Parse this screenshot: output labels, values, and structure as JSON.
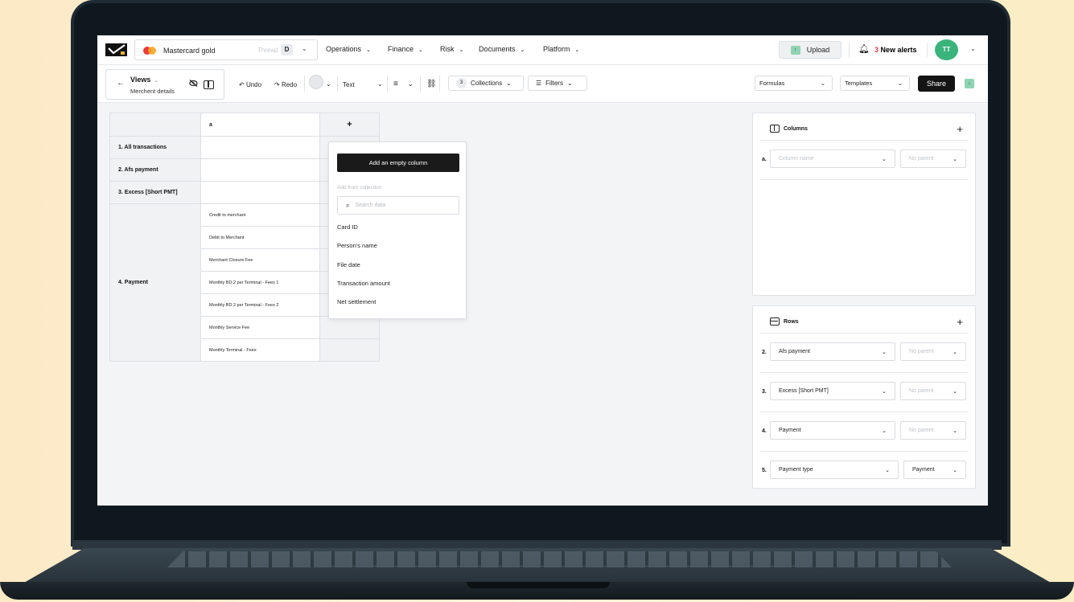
{
  "header": {
    "account_name": "Mastercard gold",
    "thread_label": "Thread",
    "thread_badge": "D",
    "nav": [
      "Operations",
      "Finance",
      "Risk",
      "Documents",
      "Platform"
    ],
    "upload_label": "Upload",
    "alerts_count": "3",
    "alerts_label": "New alerts",
    "avatar_initials": "TT"
  },
  "toolbar": {
    "views_title": "Views",
    "views_subtitle": "Merchent details",
    "undo": "Undo",
    "redo": "Redo",
    "text_style": "Text",
    "collections_count": "3",
    "collections_label": "Collections",
    "filters_label": "Filters",
    "formulas": "Formulas",
    "templates": "Templates",
    "share": "Share"
  },
  "grid": {
    "column_header": "a",
    "add_column_symbol": "+",
    "rows": [
      {
        "label": "1. All transactions"
      },
      {
        "label": "2. Afs payment"
      },
      {
        "label": "3. Excess [Short PMT]"
      }
    ],
    "payment_label": "4. Payment",
    "payment_items": [
      "Credit to merchant",
      "Debit to Merchant",
      "Merchant Closure Fee",
      "Monthly BD 2 per Terminal - Fees 1",
      "Monthly BD 2 per Terminal - Fees 2",
      "Monthly Service Fee",
      "Monthly Terminal - Fees"
    ]
  },
  "dropdown": {
    "add_empty": "Add an empty column",
    "from_collection": "Add from collection",
    "search_placeholder": "Search data",
    "items": [
      "Card ID",
      "Person's name",
      "File date",
      "Transaction amount",
      "Net settlement"
    ]
  },
  "columns_panel": {
    "title": "Columns",
    "rows": [
      {
        "index": "a.",
        "name_placeholder": "Column name",
        "parent": "No parent"
      }
    ]
  },
  "rows_panel": {
    "title": "Rows",
    "rows": [
      {
        "index": "2.",
        "name": "Afs payment",
        "parent": "No parent"
      },
      {
        "index": "3.",
        "name": "Excess [Short PMT]",
        "parent": "No parent"
      },
      {
        "index": "4.",
        "name": "Payment",
        "parent": "No parent"
      },
      {
        "index": "5.",
        "name": "Payment type",
        "parent": "Payment"
      }
    ]
  },
  "colors": {
    "accent_green": "#3bb37c",
    "alert_red": "#e0424b",
    "dark_button": "#141414"
  }
}
